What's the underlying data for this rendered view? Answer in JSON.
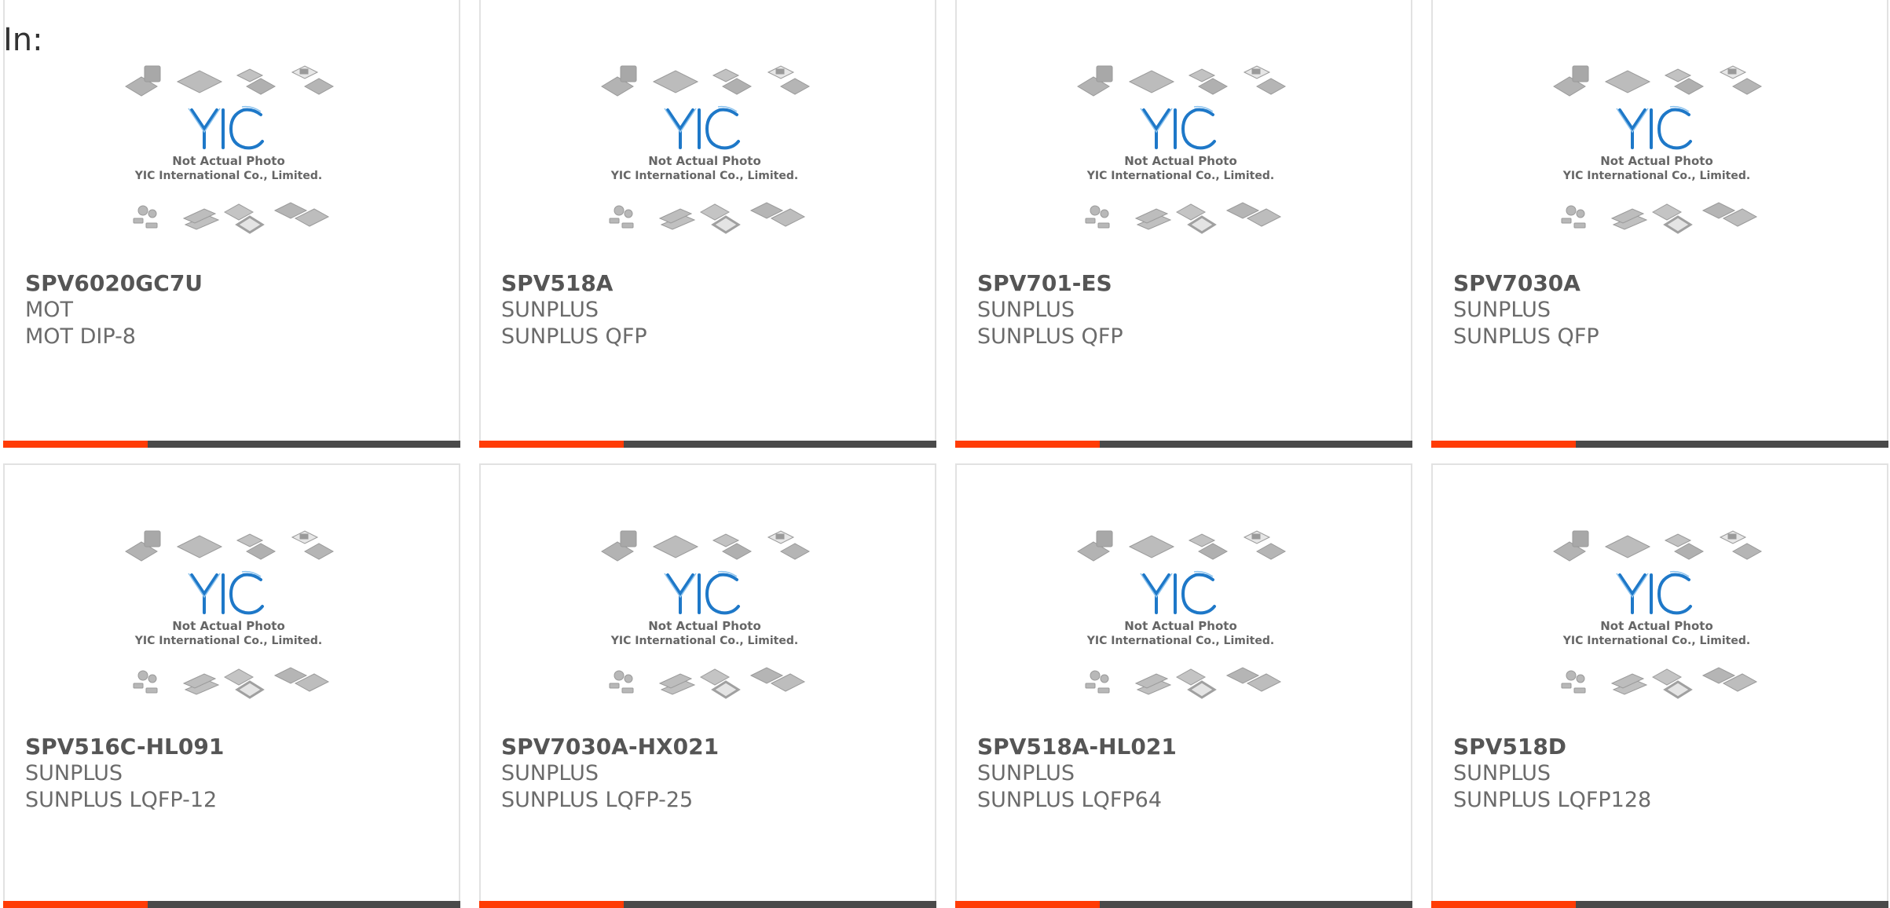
{
  "filter": {
    "label": "In:"
  },
  "thumbnail": {
    "caption_line1": "Not Actual Photo",
    "caption_line2": "YIC International Co., Limited.",
    "brand_color": "#1e78c8",
    "accent_color": "#ff3c06",
    "bar_color": "#4a4a4a"
  },
  "products": [
    {
      "part_number": "SPV6020GC7U",
      "manufacturer": "MOT",
      "package": "MOT DIP-8"
    },
    {
      "part_number": "SPV518A",
      "manufacturer": "SUNPLUS",
      "package": "SUNPLUS QFP"
    },
    {
      "part_number": "SPV701-ES",
      "manufacturer": "SUNPLUS",
      "package": "SUNPLUS QFP"
    },
    {
      "part_number": "SPV7030A",
      "manufacturer": "SUNPLUS",
      "package": "SUNPLUS QFP"
    },
    {
      "part_number": "SPV516C-HL091",
      "manufacturer": "SUNPLUS",
      "package": "SUNPLUS LQFP-12"
    },
    {
      "part_number": "SPV7030A-HX021",
      "manufacturer": "SUNPLUS",
      "package": "SUNPLUS LQFP-25"
    },
    {
      "part_number": "SPV518A-HL021",
      "manufacturer": "SUNPLUS",
      "package": "SUNPLUS LQFP64"
    },
    {
      "part_number": "SPV518D",
      "manufacturer": "SUNPLUS",
      "package": "SUNPLUS LQFP128"
    }
  ]
}
